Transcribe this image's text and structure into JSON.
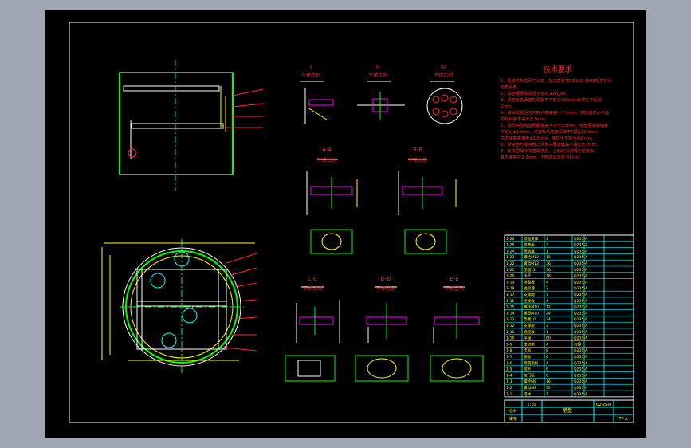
{
  "tech_requirements": {
    "title": "技术要求",
    "lines": [
      "1、零部件制造尺寸公差、加工质量按GB150-1998规范执行",
      "   检查验收。",
      "2、塔盘钢板铆焊后不能有尖锐边缘。",
      "3、塔盘板支承面的局部不平度在300mm长度内不超过",
      "   2mm。",
      "4、塔板安装后任何两点高度差小于3mm，塔板面对水平面",
      "   的倾斜度不得大于2mm。",
      "5、相邻两层塔盘间距偏差不大于±3mm，塔盘圈高度偏差",
      "   不超过±10mm，塔盘板与塔体间隙不得超过10mm。",
      "   溢流堰高度偏差±1.5mm，堰顶水平度为±2mm。",
      "6、受液盘与降液板之间水平距离偏差不超过±3mm。",
      "7、支撑圈及受液盘焊接后，上面的溢流堰与塔盘板，",
      "   其平面度在2-3mm，下面的溢流堰为1mm。"
    ]
  },
  "views": {
    "detail_I": {
      "roman": "I",
      "scale": "不锈比例"
    },
    "detail_II": {
      "roman": "II",
      "scale": "不锈比例"
    },
    "detail_III": {
      "roman": "III",
      "scale": "不锈比例"
    },
    "section_AA": {
      "label": "A-A",
      "scale": "不锈比例"
    },
    "section_BB": {
      "label": "B-B",
      "scale": "不锈比例"
    },
    "section_CC": {
      "label": "C-C",
      "scale": "不锈比例"
    },
    "section_DD": {
      "label": "D-D",
      "scale": "不锈比例"
    },
    "section_EE": {
      "label": "E-E",
      "scale": "不锈比例"
    }
  },
  "parts_table": {
    "rows": [
      [
        "1-26",
        "塔盘支撑",
        "1",
        "Q235-A"
      ],
      [
        "1-25",
        "降液板",
        "2",
        "Q235-A"
      ],
      [
        "1-24",
        "受液盘",
        "1",
        "Q235-A"
      ],
      [
        "1-23",
        "螺栓M12",
        "18",
        "Q235-A"
      ],
      [
        "1-22",
        "螺母M12",
        "36",
        "Q235-A"
      ],
      [
        "1-21",
        "垫圈12",
        "36",
        "Q235-A"
      ],
      [
        "1-20",
        "卡子",
        "18",
        "Q235-A"
      ],
      [
        "1-19",
        "塔盘板",
        "4",
        "Q235-A"
      ],
      [
        "1-18",
        "溢流堰",
        "2",
        "Q235-A"
      ],
      [
        "1-17",
        "支撑圈",
        "1",
        "Q235-A"
      ],
      [
        "1-16",
        "连接板",
        "4",
        "Q235-A"
      ],
      [
        "1-15",
        "螺栓M10",
        "12",
        "Q235-A"
      ],
      [
        "1-14",
        "螺母M10",
        "24",
        "Q235-A"
      ],
      [
        "1-13",
        "垫圈10",
        "24",
        "Q235-A"
      ],
      [
        "1-12",
        "支撑梁",
        "2",
        "Q235-A"
      ],
      [
        "1-11",
        "通道板",
        "1",
        "Q235-A"
      ],
      [
        "1-10",
        "浮阀",
        "60",
        "Q235-A"
      ],
      [
        "1-9",
        "密封垫",
        "4",
        "石棉"
      ],
      [
        "1-8",
        "卡板",
        "8",
        "Q235-A"
      ],
      [
        "1-7",
        "筋板",
        "6",
        "Q235-A"
      ],
      [
        "1-6",
        "椭圆垫板",
        "4",
        "Q235-A"
      ],
      [
        "1-5",
        "楔卡",
        "6",
        "Q235-A"
      ],
      [
        "1-4",
        "龙门板",
        "6",
        "Q235-A"
      ],
      [
        "1-3",
        "螺栓M8",
        "16",
        "Q235-A"
      ],
      [
        "1-2",
        "螺母M8",
        "32",
        "Q235-A"
      ],
      [
        "1-1",
        "塔体",
        "1",
        "Q235-A"
      ]
    ]
  },
  "title_block": {
    "name": "塔盘",
    "drawing_no": "TP-A",
    "scale": "1:10",
    "material": "Q235-A",
    "designer": "设计",
    "checker": "审核"
  },
  "colors": {
    "background": "#000000",
    "frame": "#ffffff",
    "geometry": "#00ff00",
    "annotation": "#ff2a2a",
    "dimension": "#ffff00",
    "table": "#00ffff",
    "hatch": "#ff00ff"
  }
}
